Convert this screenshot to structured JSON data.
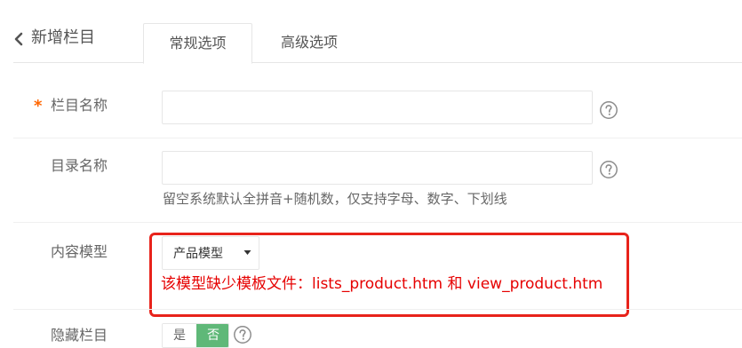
{
  "header": {
    "back_icon": "chevron-left-icon",
    "title": "新增栏目"
  },
  "tabs": [
    {
      "label": "常规选项",
      "active": true
    },
    {
      "label": "高级选项",
      "active": false
    }
  ],
  "form": {
    "column_name": {
      "label": "栏目名称",
      "required_mark": "*",
      "value": "",
      "help_icon": "question-circle-icon"
    },
    "directory_name": {
      "label": "目录名称",
      "value": "",
      "hint": "留空系统默认全拼音+随机数，仅支持字母、数字、下划线",
      "help_icon": "question-circle-icon"
    },
    "content_model": {
      "label": "内容模型",
      "selected": "产品模型",
      "arrow_icon": "caret-down-icon",
      "error": "该模型缺少模板文件：lists_product.htm 和 view_product.htm"
    },
    "hidden_column": {
      "label": "隐藏栏目",
      "options": [
        "是",
        "否"
      ],
      "selected": "否",
      "help_icon": "question-circle-icon"
    }
  },
  "colors": {
    "error_text": "#e60000",
    "highlight_border": "#e8231b",
    "required_mark": "#ff6600",
    "toggle_active": "#5fb878"
  }
}
